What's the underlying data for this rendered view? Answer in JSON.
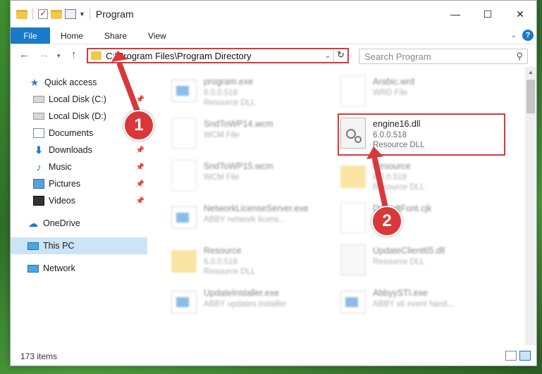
{
  "window": {
    "title": "Program",
    "controls": {
      "minimize": "—",
      "maximize": "☐",
      "close": "✕"
    }
  },
  "ribbon": {
    "tabs": [
      "File",
      "Home",
      "Share",
      "View"
    ],
    "help": "?"
  },
  "address": {
    "path": "C:\\Program Files\\Program Directory",
    "search_placeholder": "Search Program"
  },
  "nav": {
    "items": [
      {
        "label": "Quick access",
        "icon": "star-icon"
      },
      {
        "label": "Local Disk (C:)",
        "icon": "disk-icon"
      },
      {
        "label": "Local Disk (D:)",
        "icon": "disk-icon"
      },
      {
        "label": "Documents",
        "icon": "documents-icon"
      },
      {
        "label": "Downloads",
        "icon": "downloads-icon"
      },
      {
        "label": "Music",
        "icon": "music-icon"
      },
      {
        "label": "Pictures",
        "icon": "pictures-icon"
      },
      {
        "label": "Videos",
        "icon": "videos-icon"
      },
      {
        "label": "OneDrive",
        "icon": "onedrive-icon"
      },
      {
        "label": "This PC",
        "icon": "this-pc-icon"
      },
      {
        "label": "Network",
        "icon": "network-icon"
      }
    ],
    "selected": "This PC"
  },
  "files": [
    {
      "name": "program.exe",
      "line1": "6.0.0.518",
      "line2": "Resource DLL"
    },
    {
      "name": "Arabic.wrd",
      "line1": "WRD File",
      "line2": ""
    },
    {
      "name": "SndToWP14.wcm",
      "line1": "WCM File",
      "line2": ""
    },
    {
      "name": "engine16.dll",
      "line1": "6.0.0.518",
      "line2": "Resource DLL"
    },
    {
      "name": "SndToWP15.wcm",
      "line1": "WCM File",
      "line2": ""
    },
    {
      "name": "Resource",
      "line1": "6.0.0.518",
      "line2": "Resource DLL"
    },
    {
      "name": "NetworkLicenseServer.exe",
      "line1": "ABBY network licens...",
      "line2": ""
    },
    {
      "name": "DefaultFont.cjk",
      "line1": "",
      "line2": ""
    },
    {
      "name": "Resource",
      "line1": "6.0.0.518",
      "line2": "Resource DLL"
    },
    {
      "name": "UpdateClient65.dll",
      "line1": "Resource DLL",
      "line2": ""
    },
    {
      "name": "UpdateInstaller.exe",
      "line1": "ABBY updates installer",
      "line2": ""
    },
    {
      "name": "AbbyySTI.exe",
      "line1": "ABBY sti event hand...",
      "line2": ""
    }
  ],
  "status": {
    "count": "173 items"
  },
  "callouts": [
    "1",
    "2"
  ],
  "colors": {
    "accent": "#1979ca",
    "highlight": "#d9383a",
    "selected_bg": "#cce4f7"
  }
}
